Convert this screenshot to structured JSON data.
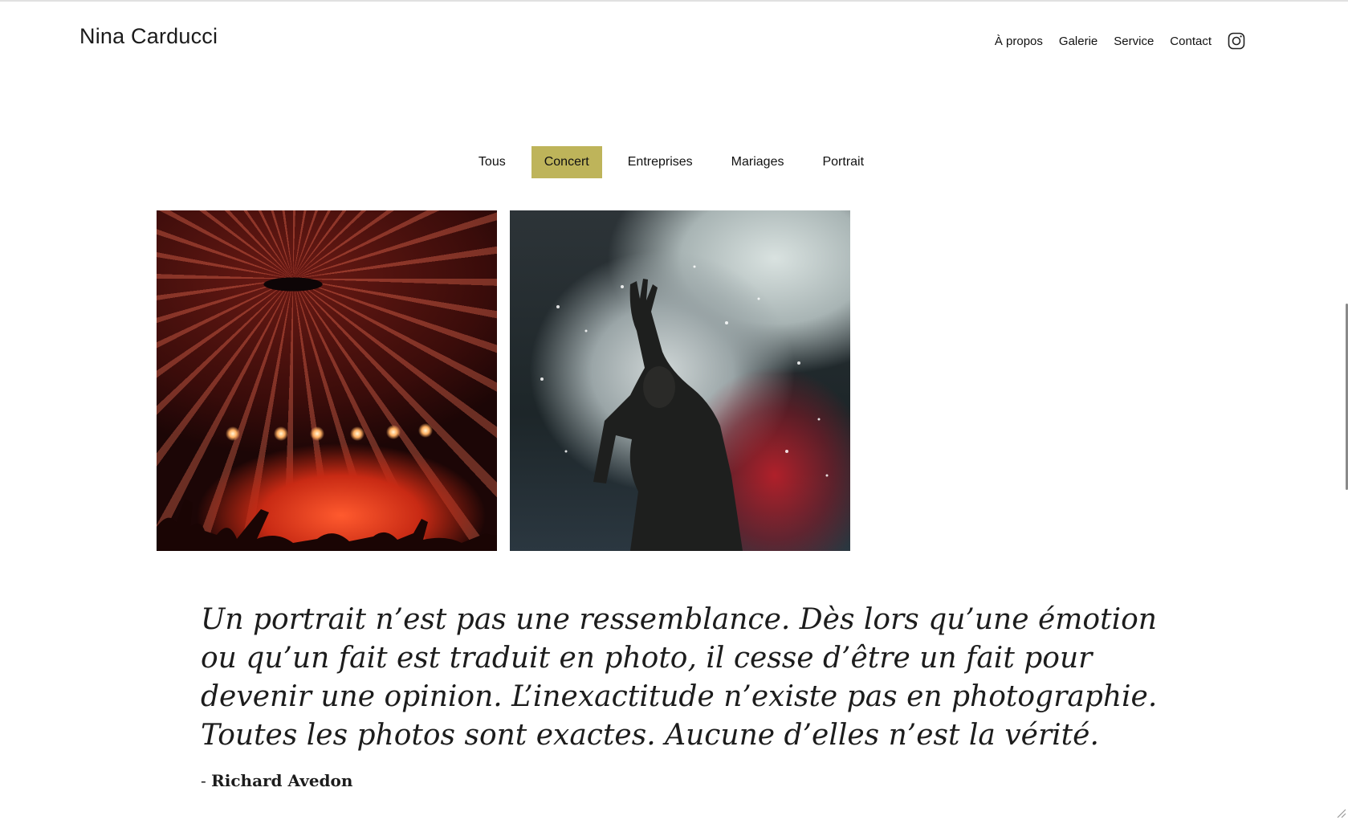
{
  "brand": "Nina Carducci",
  "nav": {
    "items": [
      "À propos",
      "Galerie",
      "Service",
      "Contact"
    ],
    "instagram_icon": "instagram-icon"
  },
  "filters": {
    "items": [
      "Tous",
      "Concert",
      "Entreprises",
      "Mariages",
      "Portrait"
    ],
    "active": "Concert",
    "accent_color": "#beb45a"
  },
  "gallery": {
    "photos": [
      {
        "name": "concert-stage-lights-photo"
      },
      {
        "name": "singer-raised-hand-photo"
      }
    ]
  },
  "quote": {
    "text": "Un portrait n’est pas une ressemblance. Dès lors qu’une émotion ou qu’un fait est traduit en photo, il cesse d’être un fait pour devenir une opinion. L’inexactitude n’existe pas en photographie. Toutes les photos sont exactes. Aucune d’elles n’est la vérité.",
    "dash": "-",
    "author": "Richard Avedon"
  }
}
